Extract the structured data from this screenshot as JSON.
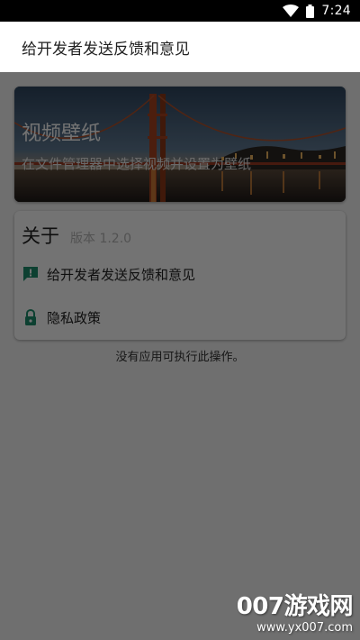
{
  "status_bar": {
    "time": "7:24",
    "icons": [
      "wifi-icon",
      "battery-icon"
    ]
  },
  "toolbar": {
    "title": "给开发者发送反馈和意见"
  },
  "hero": {
    "title": "视频壁纸",
    "subtitle": "在文件管理器中选择视频并设置为壁纸"
  },
  "about": {
    "title": "关于",
    "version": "版本 1.2.0",
    "items": [
      {
        "label": "给开发者发送反馈和意见",
        "icon": "feedback-icon"
      },
      {
        "label": "隐私政策",
        "icon": "lock-icon"
      }
    ]
  },
  "toast": {
    "text": "没有应用可执行此操作。"
  },
  "watermark": {
    "main": "007游戏网",
    "url": "www.yx007.com"
  },
  "colors": {
    "accent_icon": "#1e8f6e",
    "overlay": "rgba(0,0,0,0.55)"
  }
}
